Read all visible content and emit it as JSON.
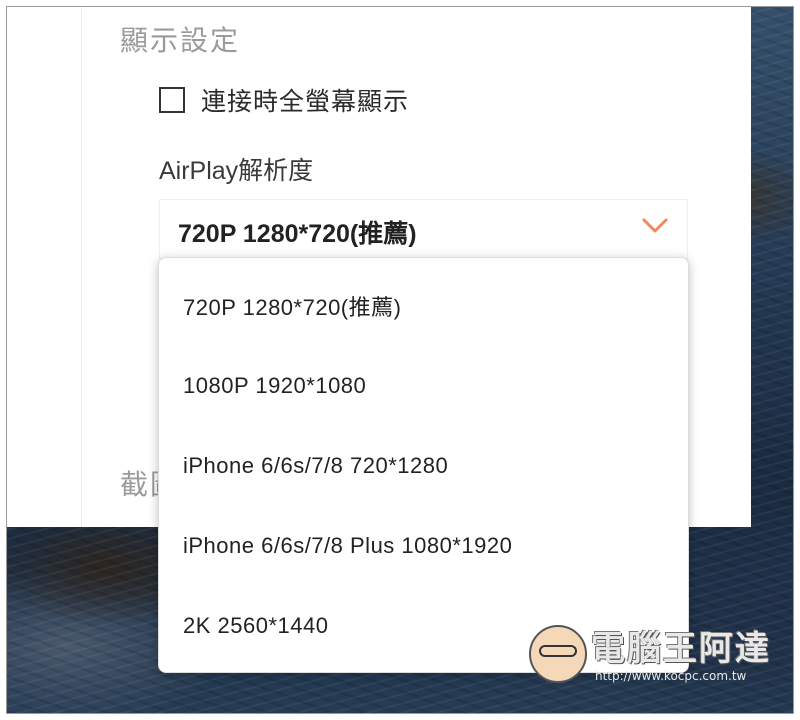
{
  "display_settings": {
    "title": "顯示設定",
    "fullscreen_checkbox": {
      "label": "連接時全螢幕顯示",
      "checked": false
    },
    "resolution_label": "AirPlay解析度",
    "resolution_select": {
      "selected": "720P 1280*720(推薦)",
      "chevron_color": "#f08a5d"
    }
  },
  "screenshot_section": {
    "title_partial": "截圖"
  },
  "dropdown": {
    "options": [
      "720P 1280*720(推薦)",
      "1080P 1920*1080",
      "iPhone 6/6s/7/8 720*1280",
      "iPhone 6/6s/7/8 Plus 1080*1920",
      "2K 2560*1440"
    ]
  },
  "watermark": {
    "title": "電腦王阿達",
    "url": "http://www.kocpc.com.tw"
  }
}
